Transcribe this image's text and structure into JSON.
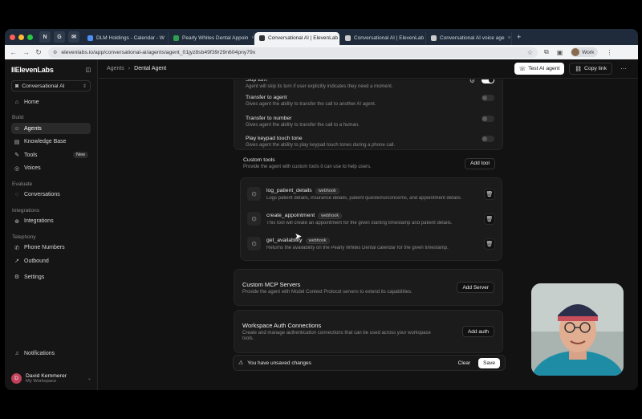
{
  "colors": {
    "accent": "#ffffff",
    "bg": "#121212",
    "card": "#1b1b1b",
    "muted": "#8c8c8c"
  },
  "browser": {
    "pinned": [
      "N",
      "G",
      "✉"
    ],
    "tabs": [
      {
        "label": "DLM Holdings - Calendar - W",
        "fav": "#4f8ef7",
        "active": false
      },
      {
        "label": "Pearly Whites Dental Appoin",
        "fav": "#2e9e4f",
        "active": false
      },
      {
        "label": "Conversational AI | ElevenLab",
        "fav": "#333333",
        "active": true
      },
      {
        "label": "Conversational AI | ElevenLab",
        "fav": "#cccccc",
        "active": false
      },
      {
        "label": "Conversational AI voice age",
        "fav": "#cccccc",
        "active": false
      }
    ],
    "url": "elevenlabs.io/app/conversational-ai/agents/agent_01jyz8sb49f39r29n604pny79x",
    "profile": "Work"
  },
  "sidebar": {
    "logo": "IIElevenLabs",
    "product": "Conversational AI",
    "home": "Home",
    "build_label": "Build",
    "build": [
      {
        "label": "Agents",
        "icon": "agents-icon",
        "glyph": "☺",
        "active": true,
        "badge": ""
      },
      {
        "label": "Knowledge Base",
        "icon": "book-icon",
        "glyph": "▤",
        "active": false,
        "badge": ""
      },
      {
        "label": "Tools",
        "icon": "wrench-icon",
        "glyph": "✎",
        "active": false,
        "badge": "New"
      },
      {
        "label": "Voices",
        "icon": "voices-icon",
        "glyph": "◎",
        "active": false,
        "badge": ""
      }
    ],
    "evaluate_label": "Evaluate",
    "conversations": "Conversations",
    "integrations_label": "Integrations",
    "integrations": "Integrations",
    "telephony_label": "Telephony",
    "phone_numbers": "Phone Numbers",
    "outbound": "Outbound",
    "settings": "Settings",
    "notifications": "Notifications",
    "user": {
      "initial": "D",
      "name": "David Kemmerer",
      "workspace": "My Workspace"
    }
  },
  "header": {
    "crumbs": [
      "Agents",
      "Dental Agent"
    ],
    "test_button": "Test AI agent",
    "copy_button": "Copy link"
  },
  "system_tools": [
    {
      "title": "Skip turn",
      "desc": "Agent will skip its turn if user explicitly indicates they need a moment.",
      "on": true
    },
    {
      "title": "Transfer to agent",
      "desc": "Gives agent the ability to transfer the call to another AI agent.",
      "on": false
    },
    {
      "title": "Transfer to number",
      "desc": "Gives agent the ability to transfer the call to a human.",
      "on": false
    },
    {
      "title": "Play keypad touch tone",
      "desc": "Gives agent the ability to play keypad touch tones during a phone call.",
      "on": false
    }
  ],
  "custom_tools": {
    "title": "Custom tools",
    "desc": "Provide the agent with custom tools it can use to help users.",
    "add_label": "Add tool",
    "items": [
      {
        "name": "log_patient_details",
        "tag": "webhook",
        "desc": "Logs patient details, insurance details, patient questions/concerns, and appointment details."
      },
      {
        "name": "create_appointment",
        "tag": "webhook",
        "desc": "This tool will create an appointment for the given starting timestamp and patient details."
      },
      {
        "name": "get_availability",
        "tag": "webhook",
        "desc": "Returns the availability on the Pearly Whites Dental calendar for the given timestamp."
      }
    ]
  },
  "mcp": {
    "title": "Custom MCP Servers",
    "desc": "Provide the agent with Model Context Protocol servers to extend its capabilities.",
    "button": "Add Server"
  },
  "auth": {
    "title": "Workspace Auth Connections",
    "desc_line1": "Create and manage authentication connections that can be used across your workspace",
    "desc_line2": "tools.",
    "button": "Add auth"
  },
  "unsaved": {
    "text": "You have unsaved changes",
    "clear": "Clear",
    "save": "Save"
  }
}
